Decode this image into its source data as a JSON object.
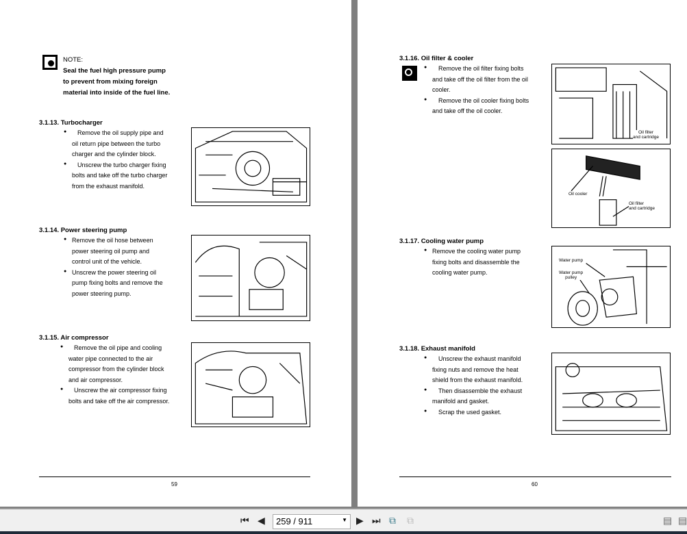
{
  "left_page": {
    "note": {
      "title": "NOTE:",
      "lines": [
        "Seal the fuel high pressure pump",
        "to prevent from mixing foreign",
        "material into inside of the fuel line."
      ]
    },
    "sections": [
      {
        "title": "3.1.13. Turbocharger",
        "bullets": [
          [
            "Remove the oil supply pipe and",
            "oil return pipe between the turbo",
            "charger and the cylinder block."
          ],
          [
            "Unscrew the turbo charger fixing",
            "bolts and take off the turbo charger",
            "from the exhaust manifold."
          ]
        ]
      },
      {
        "title": "3.1.14. Power steering pump",
        "bullets": [
          [
            "Remove the oil hose between",
            "power steering oil pump and",
            "control unit of the vehicle."
          ],
          [
            "Unscrew the power steering oil",
            "pump fixing bolts and remove the",
            "power steering pump."
          ]
        ]
      },
      {
        "title": "3.1.15. Air compressor",
        "bullets": [
          [
            "Remove the oil pipe and cooling",
            "water pipe connected to the air",
            "compressor from the cylinder block",
            "and air compressor."
          ],
          [
            "Unscrew the air compressor fixing",
            "bolts and take off the air compressor."
          ]
        ]
      }
    ],
    "page_number": "59"
  },
  "right_page": {
    "sections": [
      {
        "title": "3.1.16. Oil filter & cooler",
        "bullets": [
          [
            "Remove the oil filter fixing bolts",
            "and take off the oil filter from the oil",
            "cooler."
          ],
          [
            "Remove the oil cooler fixing bolts",
            "and take off the oil cooler."
          ]
        ]
      },
      {
        "title": "3.1.17. Cooling water pump",
        "bullets": [
          [
            "Remove the cooling water pump",
            "fixing bolts and disassemble the",
            "cooling water pump."
          ]
        ]
      },
      {
        "title": "3.1.18. Exhaust manifold",
        "bullets": [
          [
            "Unscrew the exhaust manifold",
            "fixing nuts and remove the heat",
            "shield from the exhaust manifold."
          ],
          [
            "Then disassemble the exhaust",
            "manifold and gasket."
          ],
          [
            "Scrap the used gasket."
          ]
        ]
      }
    ],
    "labels": {
      "oil_filter_1": [
        "Oil filter",
        "and cartridge"
      ],
      "oil_cooler": "Oil cooler",
      "oil_filter_2": [
        "Oil filter",
        "and cartridge"
      ],
      "water_pump": "Water pump",
      "water_pump_pulley": [
        "Water pump",
        "pulley"
      ]
    },
    "page_number": "60"
  },
  "toolbar": {
    "page_field": "259 / 911"
  }
}
